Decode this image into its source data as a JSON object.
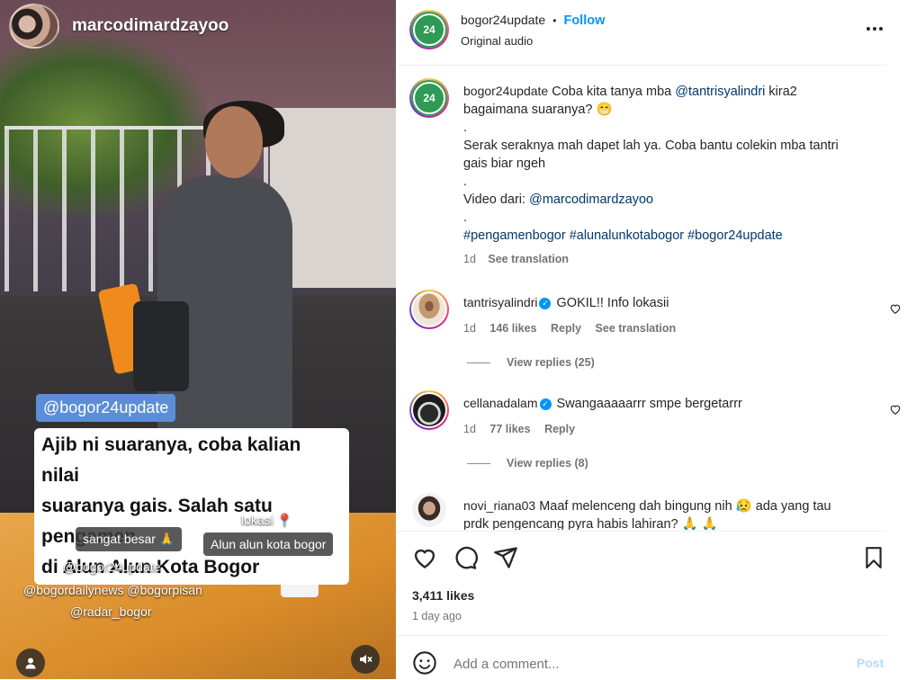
{
  "video": {
    "username": "marcodimardzayoo",
    "tag_pill": "@bogor24update",
    "caption_lines": [
      "Ajib ni suaranya, coba kalian nilai",
      "suaranya gais. Salah satu pengamen",
      "di Alun Alun Kota Bogor"
    ],
    "overlay_lokasi": "lokasi 📍",
    "overlay_sangat": "sangat besar 🙏",
    "overlay_alun": "Alun alun kota bogor",
    "overlay_mentions": [
      "@bogor24update",
      "@bogordailynews @bogorpisan",
      "@radar_bogor"
    ]
  },
  "header": {
    "account": "bogor24update",
    "separator": "•",
    "follow": "Follow",
    "audio": "Original audio",
    "logo_text": "24"
  },
  "post": {
    "author": "bogor24update",
    "text_1a": "Coba kita tanya mba ",
    "mention_1": "@tantrisyalindri",
    "text_1b": " kira2 bagaimana suaranya? 😁",
    "dot1": ".",
    "text_2": "Serak seraknya mah dapet lah ya. Coba bantu colekin mba tantri gais biar ngeh",
    "dot2": ".",
    "text_3a": "Video dari: ",
    "mention_2": "@marcodimardzayoo",
    "dot3": ".",
    "hashtags": "#pengamenbogor #alunalunkotabogor #bogor24update",
    "time": "1d",
    "see_translation": "See translation"
  },
  "comments": [
    {
      "user": "tantrisyalindri",
      "text": "GOKIL!! Info lokasii",
      "time": "1d",
      "likes": "146 likes",
      "reply": "Reply",
      "see_translation": "See translation",
      "view_replies": "View replies (25)"
    },
    {
      "user": "cellanadalam",
      "text": "Swangaaaaarrr smpe bergetarrr",
      "time": "1d",
      "likes": "77 likes",
      "reply": "Reply",
      "view_replies": "View replies (8)"
    },
    {
      "user": "novi_riana03",
      "text": "Maaf melenceng dah bingung nih 😥 ada yang tau prdk pengencang pyra habis lahiran? 🙏 🙏"
    }
  ],
  "likes_count": "3,411 likes",
  "posted_ago": "1 day ago",
  "add_comment": {
    "placeholder": "Add a comment...",
    "post_label": "Post"
  },
  "colors": {
    "link": "#00376b",
    "follow": "#0095f6",
    "logo_green": "#2f9a55"
  }
}
